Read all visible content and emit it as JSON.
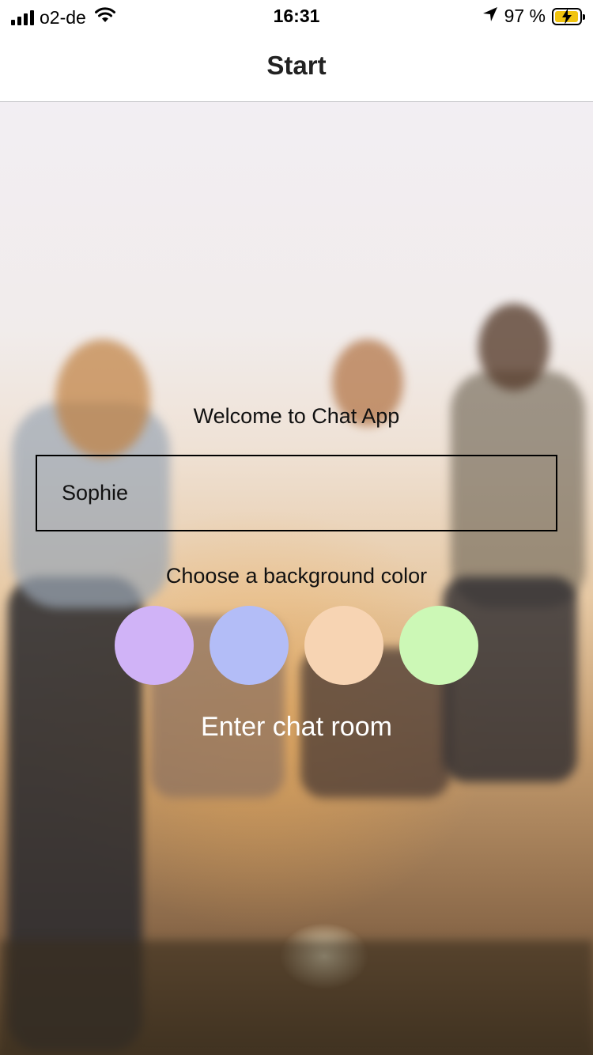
{
  "status_bar": {
    "carrier": "o2-de",
    "time": "16:31",
    "battery_percent": "97 %",
    "battery_level": 0.97,
    "icons": [
      "signal-icon",
      "wifi-icon",
      "location-arrow-icon",
      "battery-charging-icon"
    ]
  },
  "nav": {
    "title": "Start"
  },
  "start": {
    "welcome": "Welcome to Chat App",
    "name_value": "Sophie",
    "choose_label": "Choose a background color",
    "colors": [
      "#D0B3F7",
      "#B3BDF7",
      "#F7D4B3",
      "#CCF8B6"
    ],
    "enter_label": "Enter chat room"
  }
}
